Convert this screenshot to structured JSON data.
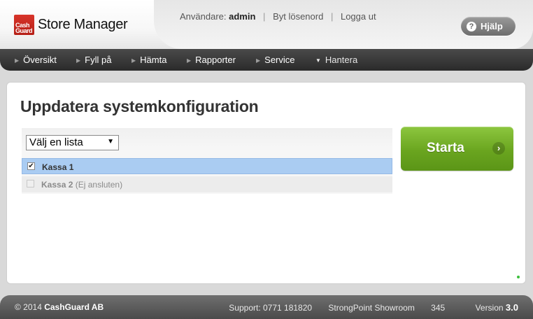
{
  "app": {
    "logo_line1": "Cash",
    "logo_line2": "Guard",
    "title": "Store Manager"
  },
  "userbar": {
    "user_label": "Användare:",
    "user_name": "admin",
    "change_password": "Byt lösenord",
    "logout": "Logga ut"
  },
  "help": {
    "icon": "question-icon",
    "label": "Hjälp"
  },
  "nav": {
    "items": [
      {
        "label": "Översikt",
        "icon": "triangle-right-icon"
      },
      {
        "label": "Fyll på",
        "icon": "triangle-right-icon"
      },
      {
        "label": "Hämta",
        "icon": "triangle-right-icon"
      },
      {
        "label": "Rapporter",
        "icon": "triangle-right-icon"
      },
      {
        "label": "Service",
        "icon": "triangle-right-icon"
      },
      {
        "label": "Hantera",
        "icon": "triangle-down-icon",
        "active": true
      }
    ]
  },
  "main": {
    "title": "Uppdatera systemkonfiguration",
    "select": {
      "value": "Välj en lista"
    },
    "rows": [
      {
        "name": "Kassa 1",
        "note": "",
        "checked": true,
        "enabled": true
      },
      {
        "name": "Kassa 2",
        "note": "(Ej ansluten)",
        "checked": false,
        "enabled": false
      }
    ],
    "start_button": "Starta"
  },
  "footer": {
    "copyright_prefix": "© 2014",
    "company": "CashGuard AB",
    "support": "Support: 0771 181820",
    "store_name": "StrongPoint Showroom",
    "store_number": "345",
    "version_label": "Version",
    "version_number": "3.0"
  },
  "colors": {
    "accent_green": "#6aa51f",
    "selected_row": "#aaccf2",
    "brand_red": "#c62a21",
    "nav_dark": "#333333"
  }
}
